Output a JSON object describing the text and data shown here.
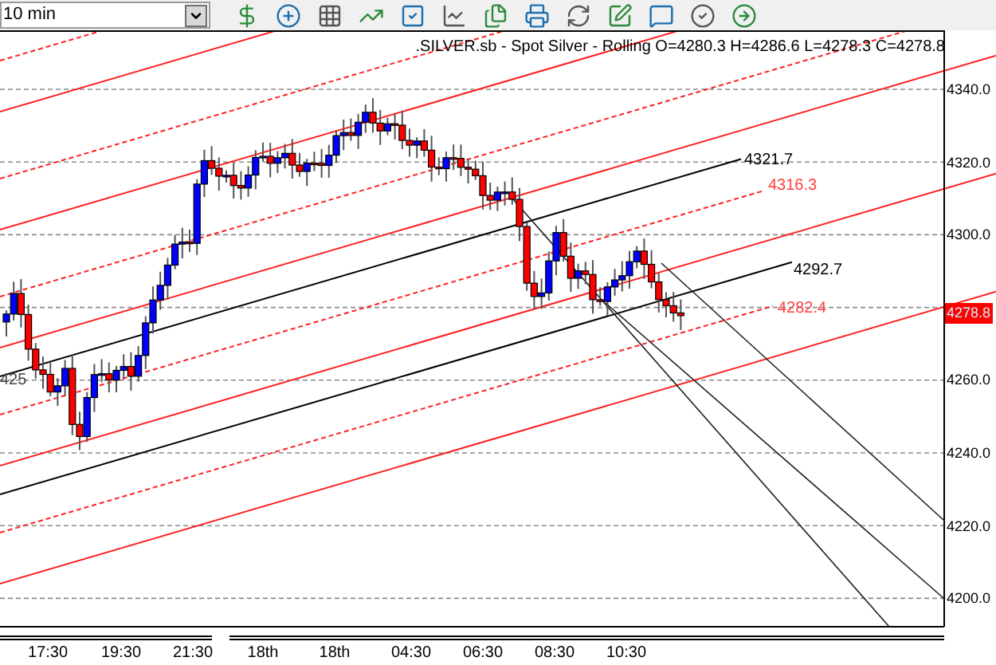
{
  "toolbar": {
    "timeframe": "10 min"
  },
  "chart": {
    "title": ".SILVER.sb - Spot Silver - Rolling O=4280.3 H=4286.6 L=4278.3 C=4278.8",
    "price_axis": [
      "4340.0",
      "4320.0",
      "4300.0",
      "4260.0",
      "4240.0",
      "4220.0",
      "4200.0"
    ],
    "current_price": "4278.8",
    "time_axis": [
      "17:30",
      "19:30",
      "21:30",
      "18th",
      "18th",
      "04:30",
      "06:30",
      "08:30",
      "10:30"
    ],
    "line_labels": [
      {
        "text": "4321.7",
        "color": "#000000"
      },
      {
        "text": "4316.3",
        "color": "#ff4040"
      },
      {
        "text": "4292.7",
        "color": "#000000"
      },
      {
        "text": "4282.4",
        "color": "#ff4040"
      }
    ],
    "covered_label": "425"
  }
}
